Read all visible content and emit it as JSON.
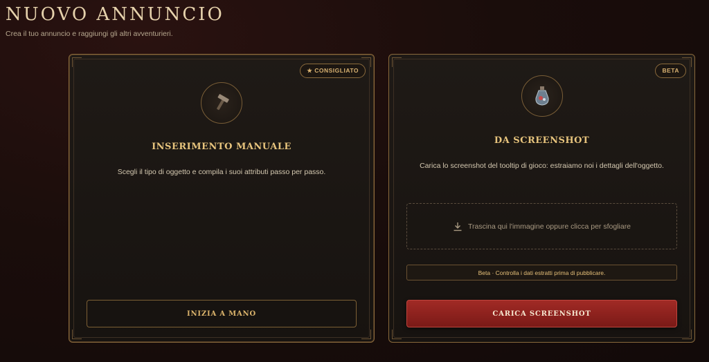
{
  "header": {
    "title": "NUOVO ANNUNCIO",
    "subtitle": "Crea il tuo annuncio e raggiungi gli altri avventurieri."
  },
  "manual": {
    "badge": "★ CONSIGLIATO",
    "icon": "hammer-icon",
    "title": "INSERIMENTO MANUALE",
    "description": "Scegli il tipo di oggetto e compila i suoi attributi passo per passo.",
    "button_label": "INIZIA A MANO"
  },
  "screenshot": {
    "badge": "BETA",
    "icon": "potion-icon",
    "title": "DA SCREENSHOT",
    "description": "Carica lo screenshot del tooltip di gioco: estraiamo noi i dettagli dell'oggetto.",
    "dropzone_text": "Trascina qui l'immagine oppure clicca per sfogliare",
    "beta_note": "Beta · Controlla i dati estratti prima di pubblicare.",
    "button_label": "CARICA SCREENSHOT"
  },
  "colors": {
    "accent_gold": "#e7c47d",
    "primary_red": "#a12a25",
    "border_gold": "#8a6a3c"
  }
}
